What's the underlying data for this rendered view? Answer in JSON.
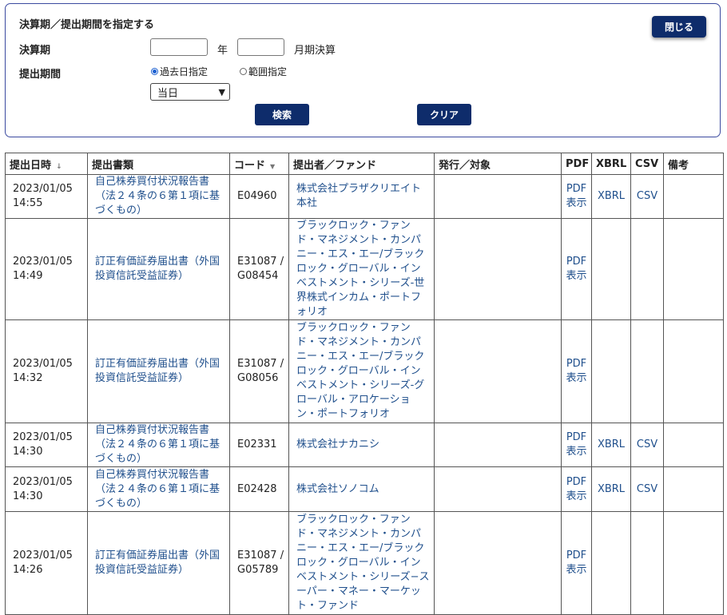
{
  "search_panel": {
    "title": "決算期／提出期間を指定する",
    "close_label": "閉じる",
    "fiscal_label": "決算期",
    "year_suffix": "年",
    "month_suffix": "月期決算",
    "fiscal_year_value": "",
    "fiscal_month_value": "",
    "period_label": "提出期間",
    "radio_past": "過去日指定",
    "radio_range": "範囲指定",
    "select_value": "当日",
    "search_label": "検索",
    "clear_label": "クリア"
  },
  "table": {
    "headers": {
      "date": "提出日時",
      "doc": "提出書類",
      "code": "コード",
      "filer": "提出者／ファンド",
      "issuer": "発行／対象",
      "pdf": "PDF",
      "xbrl": "XBRL",
      "csv": "CSV",
      "notes": "備考"
    },
    "sort_date_icon": "↓",
    "sort_code_icon": "▼",
    "rows": [
      {
        "date": "2023/01/05",
        "time": "14:55",
        "doc": "自己株券買付状況報告書（法２４条の６第１項に基づくもの）",
        "code1": "E04960",
        "code2": "",
        "filer": "株式会社プラザクリエイト本社",
        "issuer": "",
        "pdf1": "PDF",
        "pdf2": "表示",
        "xbrl": "XBRL",
        "csv": "CSV",
        "notes": ""
      },
      {
        "date": "2023/01/05",
        "time": "14:49",
        "doc": "訂正有価証券届出書（外国投資信託受益証券）",
        "code1": "E31087 /",
        "code2": "G08454",
        "filer": "ブラックロック・ファンド・マネジメント・カンパニー・エス・エー/ブラックロック・グローバル・インベストメント・シリーズ-世界株式インカム・ポートフォリオ",
        "issuer": "",
        "pdf1": "PDF",
        "pdf2": "表示",
        "xbrl": "",
        "csv": "",
        "notes": ""
      },
      {
        "date": "2023/01/05",
        "time": "14:32",
        "doc": "訂正有価証券届出書（外国投資信託受益証券）",
        "code1": "E31087 /",
        "code2": "G08056",
        "filer": "ブラックロック・ファンド・マネジメント・カンパニー・エス・エー/ブラックロック・グローバル・インベストメント・シリーズ-グローバル・アロケーション・ポートフォリオ",
        "issuer": "",
        "pdf1": "PDF",
        "pdf2": "表示",
        "xbrl": "",
        "csv": "",
        "notes": ""
      },
      {
        "date": "2023/01/05",
        "time": "14:30",
        "doc": "自己株券買付状況報告書（法２４条の６第１項に基づくもの）",
        "code1": "E02331",
        "code2": "",
        "filer": "株式会社ナカニシ",
        "issuer": "",
        "pdf1": "PDF",
        "pdf2": "表示",
        "xbrl": "XBRL",
        "csv": "CSV",
        "notes": ""
      },
      {
        "date": "2023/01/05",
        "time": "14:30",
        "doc": "自己株券買付状況報告書（法２４条の６第１項に基づくもの）",
        "code1": "E02428",
        "code2": "",
        "filer": "株式会社ソノコム",
        "issuer": "",
        "pdf1": "PDF",
        "pdf2": "表示",
        "xbrl": "XBRL",
        "csv": "CSV",
        "notes": ""
      },
      {
        "date": "2023/01/05",
        "time": "14:26",
        "doc": "訂正有価証券届出書（外国投資信託受益証券）",
        "code1": "E31087 /",
        "code2": "G05789",
        "filer": "ブラックロック・ファンド・マネジメント・カンパニー・エス・エー/ブラックロック・グローバル・インベストメント・シリーズ−スーパー・マネー・マーケット・ファンド",
        "issuer": "",
        "pdf1": "PDF",
        "pdf2": "表示",
        "xbrl": "",
        "csv": "",
        "notes": ""
      }
    ]
  }
}
